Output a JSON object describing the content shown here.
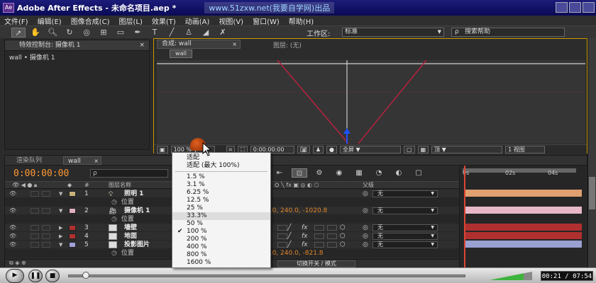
{
  "window": {
    "title": "Adobe After Effects - 未命名项目.aep *",
    "watermark": "www.51zxw.net(我要自学网)出品"
  },
  "menu": [
    "文件(F)",
    "编辑(E)",
    "图像合成(C)",
    "图层(L)",
    "效果(T)",
    "动画(A)",
    "视图(V)",
    "窗口(W)",
    "帮助(H)"
  ],
  "toolbar": {
    "workspace_label": "工作区:",
    "workspace_value": "标准",
    "search_placeholder": "搜索帮助"
  },
  "effects_panel": {
    "tab": "特效控制台: 摄像机 1",
    "breadcrumb": "wall • 摄像机 1"
  },
  "comp_panel": {
    "tab": "合成: wall",
    "layer_tab": "图层: (无)",
    "viewer_label": "wall",
    "zoom": "100 %",
    "timecode": "0:00:00:00",
    "resolution": "全屏",
    "view_mode": "顶",
    "views": "1 视图"
  },
  "timeline": {
    "render_tab": "渲染队列",
    "comp_tab": "wall",
    "timecode": "0:00:00:00",
    "search_placeholder": "ρ",
    "col_source": "图层名称",
    "col_parent": "父级",
    "col_hash": "#",
    "switch_mode": "切换开关 / 模式",
    "ruler": [
      "0s",
      "02s",
      "04s"
    ],
    "layers": [
      {
        "num": "1",
        "name": "照明 1",
        "color": "#c9b27a",
        "bar": "#e0a070"
      },
      {
        "num": "2",
        "name": "摄像机 1",
        "color": "#e0b0c0",
        "bar": "#e8b8c8"
      },
      {
        "num": "3",
        "name": "墙壁",
        "color": "#b03030",
        "bar": "#b03030"
      },
      {
        "num": "4",
        "name": "地面",
        "color": "#b03030",
        "bar": "#b03030"
      },
      {
        "num": "5",
        "name": "投影图片",
        "color": "#a0a0d8",
        "bar": "#9aa0d0"
      }
    ],
    "sub_label": "位置",
    "pos_camera": "0.0, 240.0, -1020.8",
    "pos_light": "0.0, 240.0, -1020.8",
    "pos_image": "0.0, 240.0, -821.8",
    "parent_value": "无"
  },
  "zoom_menu": {
    "items": [
      "适配",
      "适配 (最大 100%)",
      "1.5 %",
      "3.1 %",
      "6.25 %",
      "12.5 %",
      "25 %",
      "33.3%",
      "50 %",
      "100 %",
      "200 %",
      "400 %",
      "800 %",
      "1600 %"
    ],
    "checked": "100 %"
  },
  "playback": {
    "time": "00:21 / 07:54",
    "progress": 0.045
  }
}
